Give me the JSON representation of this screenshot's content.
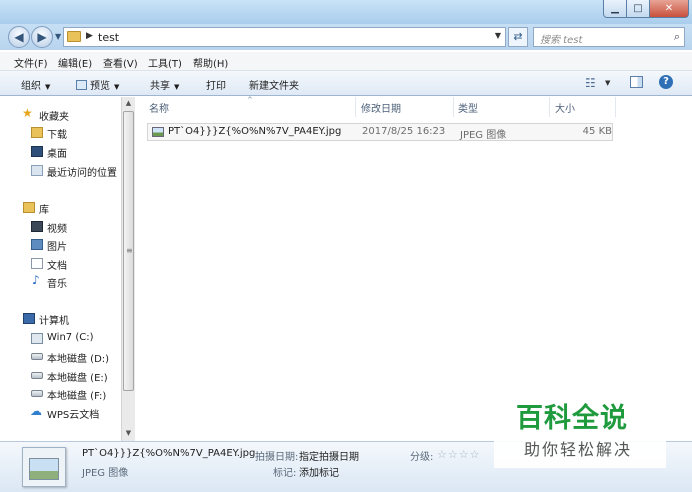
{
  "window": {
    "minimize_glyph": "▁",
    "maximize_glyph": "□",
    "close_glyph": "✕"
  },
  "address": {
    "path": "test",
    "search_placeholder": "搜索 test"
  },
  "menu": [
    "文件(F)",
    "编辑(E)",
    "查看(V)",
    "工具(T)",
    "帮助(H)"
  ],
  "toolbar": {
    "organize": "组织",
    "preview": "预览",
    "share": "共享",
    "print": "打印",
    "new_folder": "新建文件夹"
  },
  "nav": {
    "favorites": "收藏夹",
    "downloads": "下载",
    "desktop": "桌面",
    "recent": "最近访问的位置",
    "libraries": "库",
    "videos": "视频",
    "pictures": "图片",
    "documents": "文档",
    "music": "音乐",
    "computer": "计算机",
    "drive_c": "Win7 (C:)",
    "drive_d": "本地磁盘 (D:)",
    "drive_e": "本地磁盘 (E:)",
    "drive_f": "本地磁盘 (F:)",
    "wps": "WPS云文档"
  },
  "columns": {
    "name": "名称",
    "modified": "修改日期",
    "type": "类型",
    "size": "大小"
  },
  "files": [
    {
      "name": "PT`O4}}}Z{%O%N%7V_PA4EY.jpg",
      "modified": "2017/8/25 16:23",
      "type": "JPEG 图像",
      "size": "45 KB"
    }
  ],
  "details": {
    "name": "PT`O4}}}Z{%O%N%7V_PA4EY.jpg",
    "type": "JPEG 图像",
    "date_label": "拍摄日期:",
    "date_value": "指定拍摄日期",
    "tags_label": "标记:",
    "tags_value": "添加标记",
    "rating_label": "分级:"
  },
  "watermark": {
    "logo": "百科全说",
    "subtitle": "助你轻松解决"
  }
}
